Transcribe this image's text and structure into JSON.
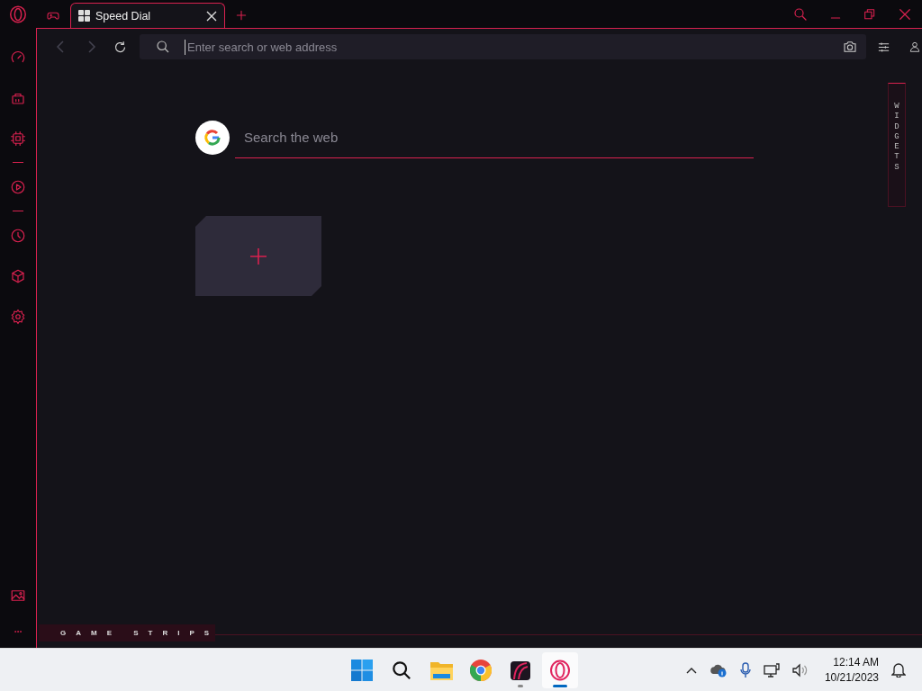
{
  "tabs": [
    {
      "title": "Speed Dial",
      "selected": true
    }
  ],
  "address_bar": {
    "placeholder": "Enter search or web address"
  },
  "search": {
    "placeholder": "Search the web"
  },
  "widgets_label": "WIDGETS",
  "game_strips_label": "GAME STRIPS",
  "taskbar": {
    "apps": [
      {
        "kind": "start",
        "running": false,
        "selected": false
      },
      {
        "kind": "search",
        "running": false,
        "selected": false
      },
      {
        "kind": "files",
        "running": false,
        "selected": false
      },
      {
        "kind": "chrome",
        "running": false,
        "selected": false
      },
      {
        "kind": "gx",
        "running": true,
        "selected": false
      },
      {
        "kind": "opera",
        "running": true,
        "selected": true
      }
    ],
    "time": "12:14 AM",
    "date": "10/21/2023"
  }
}
